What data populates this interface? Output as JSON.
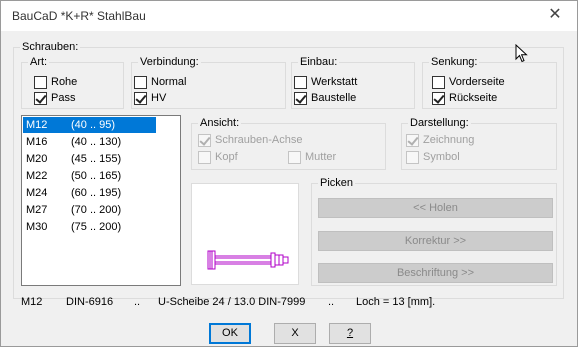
{
  "window": {
    "title": "BauCaD *K+R* StahlBau",
    "close_glyph": "✕"
  },
  "schrauben": {
    "label": "Schrauben:",
    "art": {
      "label": "Art:",
      "options": [
        {
          "label": "Rohe",
          "checked": false
        },
        {
          "label": "Pass",
          "checked": true
        }
      ]
    },
    "verbindung": {
      "label": "Verbindung:",
      "options": [
        {
          "label": "Normal",
          "checked": false
        },
        {
          "label": "HV",
          "checked": true
        }
      ]
    },
    "einbau": {
      "label": "Einbau:",
      "options": [
        {
          "label": "Werkstatt",
          "checked": false
        },
        {
          "label": "Baustelle",
          "checked": true
        }
      ]
    },
    "senkung": {
      "label": "Senkung:",
      "options": [
        {
          "label": "Vorderseite",
          "checked": false
        },
        {
          "label": "Rückseite",
          "checked": true
        }
      ]
    }
  },
  "bolts": {
    "items": [
      {
        "name": "M12",
        "range": "(40 .. 95)"
      },
      {
        "name": "M16",
        "range": "(40 .. 130)"
      },
      {
        "name": "M20",
        "range": "(45 .. 155)"
      },
      {
        "name": "M22",
        "range": "(50 .. 165)"
      },
      {
        "name": "M24",
        "range": "(60 .. 195)"
      },
      {
        "name": "M27",
        "range": "(70 .. 200)"
      },
      {
        "name": "M30",
        "range": "(75 .. 200)"
      }
    ],
    "selected": "M12"
  },
  "ansicht": {
    "label": "Ansicht:",
    "achse": "Schrauben-Achse",
    "kopf": "Kopf",
    "mutter": "Mutter"
  },
  "darstellung": {
    "label": "Darstellung:",
    "zeichnung": "Zeichnung",
    "symbol": "Symbol"
  },
  "picken": {
    "label": "Picken",
    "holen": "<< Holen",
    "korrektur": "Korrektur >>",
    "beschriftung": "Beschriftung >>"
  },
  "status": {
    "bolt": "M12",
    "norm": "DIN-6916",
    "sep1": "..",
    "scheibe": "U-Scheibe 24 / 13.0 DIN-7999",
    "sep2": "..",
    "loch": "Loch = 13 [mm]."
  },
  "buttons": {
    "ok": "OK",
    "cancel": "X",
    "help": "?"
  },
  "colors": {
    "accent": "#0078d7",
    "preview_bolt": "#b000c8"
  }
}
